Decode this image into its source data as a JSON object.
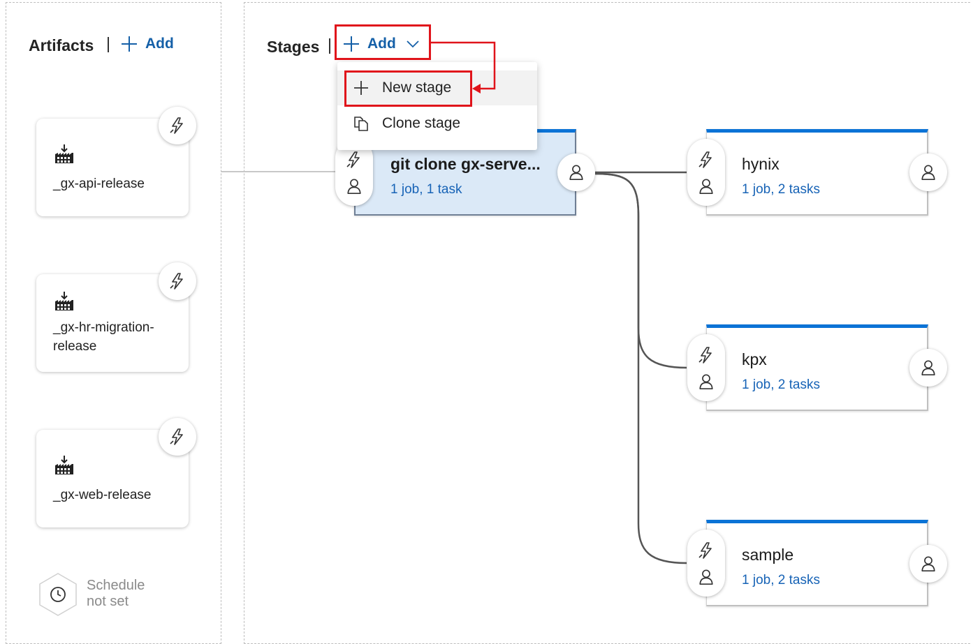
{
  "artifacts": {
    "title": "Artifacts",
    "add_label": "Add",
    "items": [
      {
        "name": "_gx-api-release"
      },
      {
        "name": "_gx-hr-migration-release"
      },
      {
        "name": "_gx-web-release"
      }
    ],
    "schedule": {
      "line1": "Schedule",
      "line2": "not set"
    }
  },
  "stages": {
    "title": "Stages",
    "add_label": "Add",
    "menu": [
      {
        "label": "New stage",
        "icon": "plus-icon"
      },
      {
        "label": "Clone stage",
        "icon": "clone-icon"
      }
    ],
    "items": [
      {
        "name": "git clone gx-serve...",
        "summary": "1 job, 1 task",
        "selected": true
      },
      {
        "name": "hynix",
        "summary": "1 job, 2 tasks"
      },
      {
        "name": "kpx",
        "summary": "1 job, 2 tasks"
      },
      {
        "name": "sample",
        "summary": "1 job, 2 tasks"
      }
    ]
  },
  "colors": {
    "accent": "#0b73d6",
    "link": "#1560a8",
    "selected_bg": "#dbe9f7",
    "annotation_red": "#e0141b"
  }
}
